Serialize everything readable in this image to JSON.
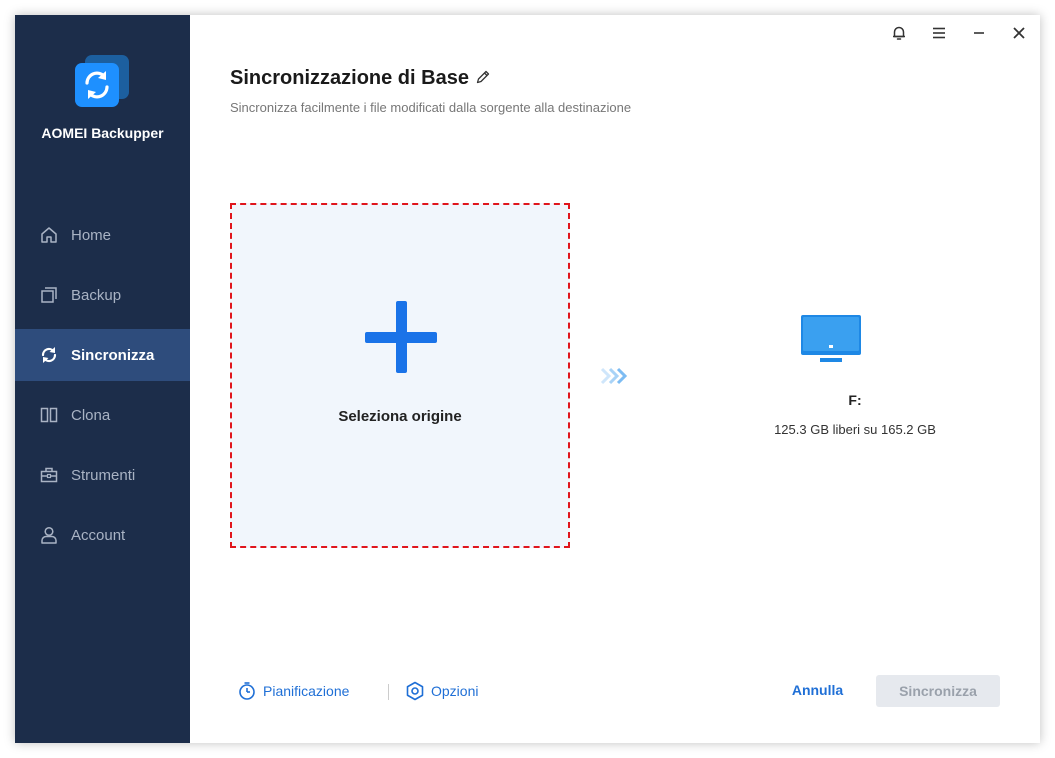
{
  "app": {
    "name": "AOMEI Backupper"
  },
  "sidebar": {
    "items": [
      {
        "label": "Home",
        "icon": "home-icon",
        "active": false
      },
      {
        "label": "Backup",
        "icon": "backup-icon",
        "active": false
      },
      {
        "label": "Sincronizza",
        "icon": "sync-icon",
        "active": true
      },
      {
        "label": "Clona",
        "icon": "clone-icon",
        "active": false
      },
      {
        "label": "Strumenti",
        "icon": "tools-icon",
        "active": false
      },
      {
        "label": "Account",
        "icon": "account-icon",
        "active": false
      }
    ]
  },
  "header": {
    "title": "Sincronizzazione di Base",
    "subtitle": "Sincronizza facilmente i file modificati dalla sorgente alla destinazione"
  },
  "source": {
    "label": "Seleziona origine"
  },
  "destination": {
    "drive": "F:",
    "space": "125.3 GB liberi su 165.2 GB"
  },
  "footer": {
    "schedule_label": "Pianificazione",
    "options_label": "Opzioni",
    "cancel_label": "Annulla",
    "sync_label": "Sincronizza"
  },
  "colors": {
    "sidebar_bg": "#1c2d4a",
    "sidebar_active": "#2e4c7c",
    "accent": "#1a73e8",
    "dashed_border": "#e0151c",
    "disabled_button": "#e6e9ee"
  }
}
